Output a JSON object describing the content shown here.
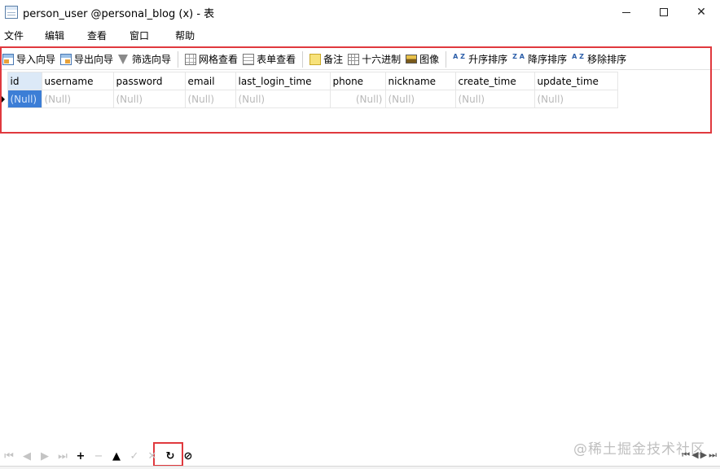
{
  "window": {
    "title": "person_user @personal_blog (x) - 表",
    "controls": {
      "close": "✕"
    }
  },
  "menu": [
    "文件",
    "编辑",
    "查看",
    "窗口",
    "帮助"
  ],
  "toolbar": {
    "import_wizard": "导入向导",
    "export_wizard": "导出向导",
    "filter_wizard": "筛选向导",
    "grid_view": "网格查看",
    "form_view": "表单查看",
    "memo": "备注",
    "hex": "十六进制",
    "image": "图像",
    "sort_asc": "升序排序",
    "sort_desc": "降序排序",
    "remove_sort": "移除排序",
    "sort_asc_icon_text": "A Z",
    "sort_desc_icon_text": "Z A",
    "remove_sort_icon_text": "A Z"
  },
  "grid": {
    "columns": [
      "id",
      "username",
      "password",
      "email",
      "last_login_time",
      "phone",
      "nickname",
      "create_time",
      "update_time"
    ],
    "rows": [
      [
        "(Null)",
        "(Null)",
        "(Null)",
        "(Null)",
        "(Null)",
        "(Null)",
        "(Null)",
        "(Null)",
        "(Null)"
      ]
    ]
  },
  "nav": {
    "first": "⏮",
    "prev": "◀",
    "next": "▶",
    "last": "⏭",
    "add": "+",
    "delete": "−",
    "up": "▲",
    "apply": "✓",
    "cancel": "✕",
    "refresh": "↻",
    "stop": "⊘"
  },
  "watermark": "@稀土掘金技术社区",
  "colors": {
    "selection": "#3c7ed6",
    "highlight": "#e0393e",
    "null_text": "#b9b9b9"
  }
}
